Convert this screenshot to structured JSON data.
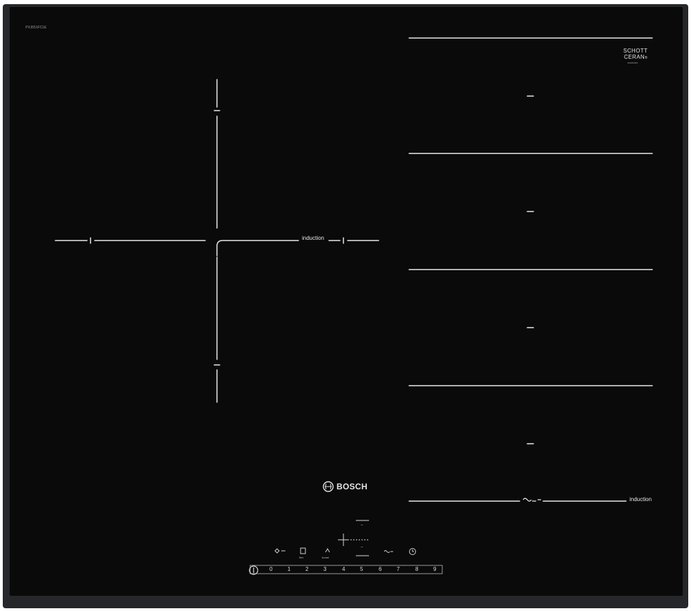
{
  "hob": {
    "model_code": "PXJ651FC1E",
    "ceran_line1": "SCHOTT",
    "ceran_line2": "CERAN",
    "ceran_mark": "®",
    "ceran_small": "000000000",
    "brand": "BOSCH",
    "zone_label_left": "induction",
    "zone_label_right": "induction"
  },
  "controls": {
    "flex_label": "flex",
    "boost_label": "boost",
    "scale": [
      "0",
      "1",
      "2",
      "3",
      "4",
      "5",
      "6",
      "7",
      "8",
      "9"
    ],
    "zone_marks": [
      "–",
      "–",
      "–",
      "–"
    ]
  },
  "colors": {
    "glass": "#0a0a0b",
    "frame": "#26272a",
    "markings": "#e8e8e8"
  }
}
